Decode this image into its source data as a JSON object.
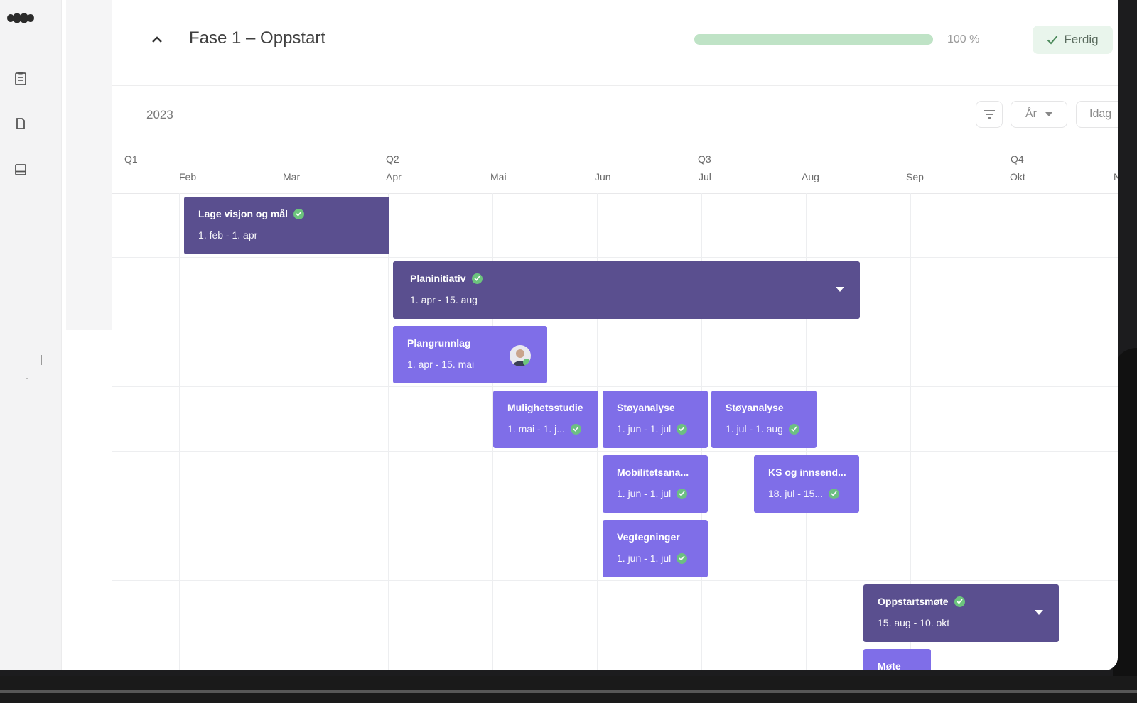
{
  "phase": {
    "title": "Fase 1 – Oppstart",
    "progress_text": "100 %",
    "progress_fraction": 1.0,
    "done_label": "Ferdig"
  },
  "toolbar": {
    "year": "2023",
    "view_label": "År",
    "today_label": "Idag"
  },
  "timeline": {
    "quarters": [
      "Q1",
      "Q2",
      "Q3",
      "Q4"
    ],
    "months": [
      "Feb",
      "Mar",
      "Apr",
      "Mai",
      "Jun",
      "Jul",
      "Aug",
      "Sep",
      "Okt",
      "N"
    ]
  },
  "tasks": [
    {
      "name": "Lage visjon og mål",
      "dates": "1. feb - 1. apr",
      "done": true
    },
    {
      "name": "Planinitiativ",
      "dates": "1. apr - 15. aug",
      "done": true
    },
    {
      "name": "Plangrunnlag",
      "dates": "1. apr - 15. mai",
      "done": true
    },
    {
      "name": "Mulighetsstudie",
      "dates": "1. mai - 1. j...",
      "done": true
    },
    {
      "name": "Støyanalyse",
      "dates": "1. jun - 1. jul",
      "done": true
    },
    {
      "name": "Støyanalyse",
      "dates": "1. jul - 1. aug",
      "done": true
    },
    {
      "name": "Mobilitetsana...",
      "dates": "1. jun - 1. jul",
      "done": true
    },
    {
      "name": "KS og innsend...",
      "dates": "18. jul - 15...",
      "done": true
    },
    {
      "name": "Vegtegninger",
      "dates": "1. jun - 1. jul",
      "done": true
    },
    {
      "name": "Oppstartsmøte",
      "dates": "15. aug - 10. okt",
      "done": true
    },
    {
      "name": "Møte",
      "dates": "",
      "done": false
    }
  ],
  "colors": {
    "task_dark": "#5a4f8f",
    "task_light": "#7f6ee8",
    "check_green": "#6cc47d",
    "progress_green": "#bfe3c6"
  },
  "icons": [
    "logo",
    "clipboard-icon",
    "document-icon",
    "inbox-icon",
    "chevron-up-icon",
    "check-icon",
    "filter-icon",
    "caret-down-icon"
  ]
}
